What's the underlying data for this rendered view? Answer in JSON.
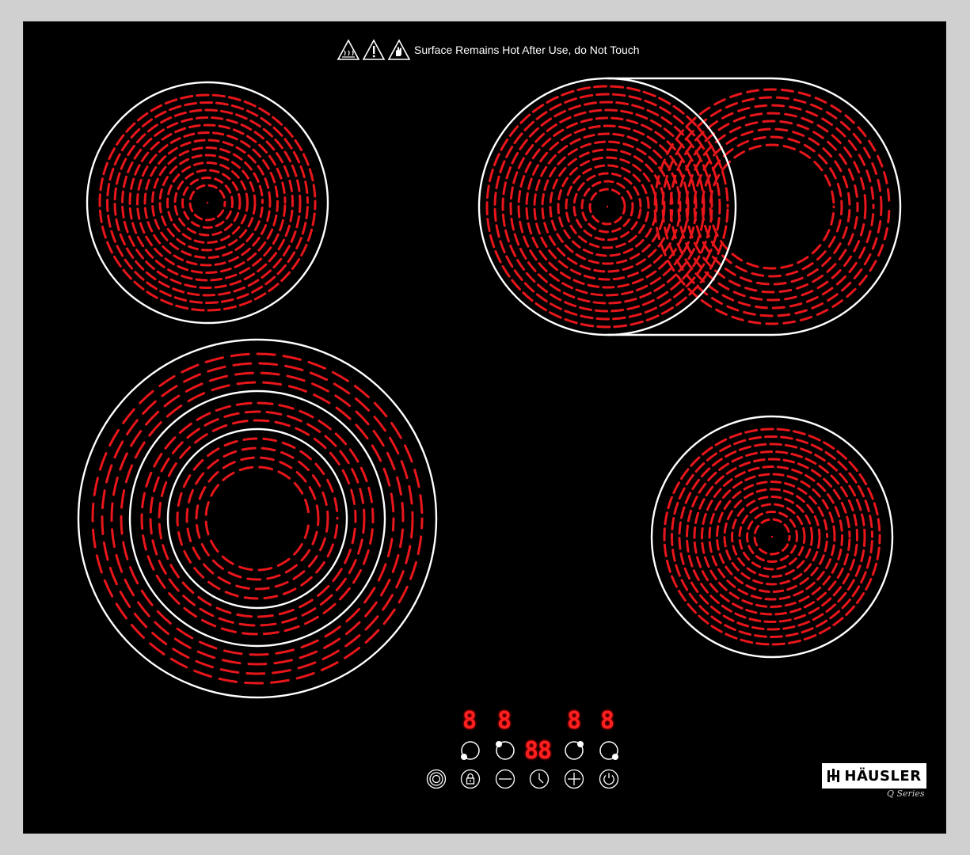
{
  "warning": {
    "text": "Surface Remains Hot After Use, do Not Touch",
    "icons": [
      "hot-surface-icon",
      "caution-icon",
      "no-touch-icon"
    ]
  },
  "zones": [
    {
      "name": "front-left-triple-zone",
      "type": "triple-ring"
    },
    {
      "name": "rear-left-zone",
      "type": "single"
    },
    {
      "name": "rear-right-oval-zone",
      "type": "dual-oval"
    },
    {
      "name": "front-right-zone",
      "type": "single"
    }
  ],
  "displays": {
    "zone1": "8",
    "zone2": "8",
    "timer": "88",
    "zone3": "8",
    "zone4": "8"
  },
  "controls": [
    {
      "name": "extra-zone-button",
      "icon": "multi-ring-icon"
    },
    {
      "name": "lock-button",
      "icon": "lock-icon"
    },
    {
      "name": "minus-button",
      "icon": "minus-icon"
    },
    {
      "name": "timer-button",
      "icon": "clock-icon"
    },
    {
      "name": "plus-button",
      "icon": "plus-icon"
    },
    {
      "name": "power-button",
      "icon": "power-icon"
    }
  ],
  "brand": {
    "name": "HÄUSLER",
    "series": "Q Series"
  },
  "colors": {
    "glass": "#000000",
    "frame": "#cfd0cf",
    "heating_element": "#e8161a",
    "ring": "#ffffff",
    "display": "#ff2020"
  }
}
